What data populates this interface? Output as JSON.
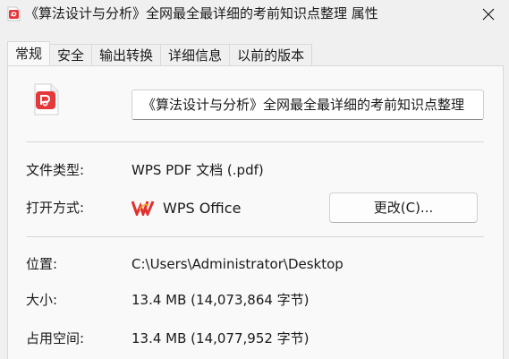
{
  "window": {
    "title": "《算法设计与分析》全网最全最详细的考前知识点整理 属性"
  },
  "tabs": [
    {
      "label": "常规",
      "active": true
    },
    {
      "label": "安全",
      "active": false
    },
    {
      "label": "输出转换",
      "active": false
    },
    {
      "label": "详细信息",
      "active": false
    },
    {
      "label": "以前的版本",
      "active": false
    }
  ],
  "general": {
    "file_name": "《算法设计与分析》全网最全最详细的考前知识点整理",
    "file_type_label": "文件类型:",
    "file_type_value": "WPS PDF 文档 (.pdf)",
    "open_with_label": "打开方式:",
    "open_with_value": "WPS Office",
    "change_button_label": "更改(C)...",
    "location_label": "位置:",
    "location_value": "C:\\Users\\Administrator\\Desktop",
    "size_label": "大小:",
    "size_value": "13.4 MB (14,073,864 字节)",
    "size_on_disk_label": "占用空间:",
    "size_on_disk_value": "13.4 MB (14,077,952 字节)"
  },
  "icons": {
    "title_icon": "pdf-file-icon",
    "file_icon": "pdf-file-icon",
    "wps_icon": "wps-office-icon",
    "close_icon": "close-icon"
  },
  "colors": {
    "pdf_red": "#e5383b",
    "wps_red": "#e0312f",
    "panel_bg": "#f9f9f9",
    "window_bg": "#f0f0f0"
  }
}
